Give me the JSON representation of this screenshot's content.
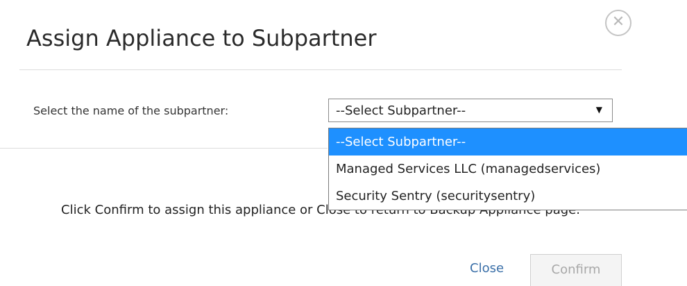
{
  "dialog": {
    "title": "Assign Appliance to Subpartner",
    "close_icon_glyph": "✕"
  },
  "form": {
    "select_label": "Select the name of the subpartner:",
    "selected_value": "--Select Subpartner--",
    "arrow_glyph": "▼",
    "options": [
      {
        "label": "--Select Subpartner--",
        "selected": true
      },
      {
        "label": "Managed Services LLC (managedservices)",
        "selected": false
      },
      {
        "label": "Security Sentry (securitysentry)",
        "selected": false
      }
    ]
  },
  "message": {
    "text": "Click Confirm to assign this appliance or Close to return to Backup Appliance page."
  },
  "actions": {
    "close_label": "Close",
    "confirm_label": "Confirm"
  },
  "colors": {
    "selected_option_bg": "#1e90ff",
    "link": "#3a6fa8",
    "disabled_text": "#a8a8a8"
  }
}
